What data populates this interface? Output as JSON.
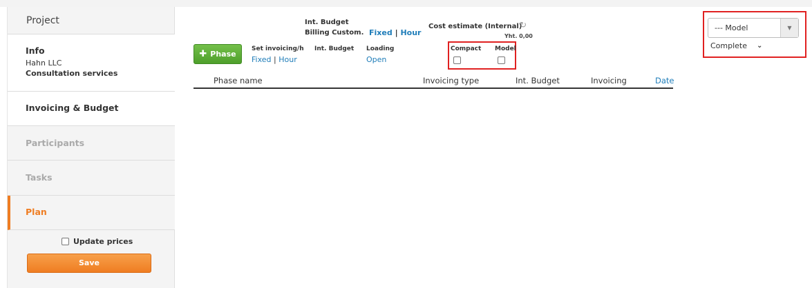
{
  "sidebar": {
    "header": "Project",
    "info_title": "Info",
    "info_client": "Hahn LLC",
    "info_service": "Consultation services",
    "items": [
      {
        "label": "Invoicing & Budget"
      },
      {
        "label": "Participants"
      },
      {
        "label": "Tasks"
      },
      {
        "label": "Plan"
      }
    ],
    "update_prices": "Update prices",
    "save": "Save"
  },
  "toolbar": {
    "int_budget": "Int. Budget",
    "billing_custom": "Billing Custom.",
    "fixed": "Fixed",
    "hour": "Hour",
    "sep": "|",
    "cost_estimate": "Cost estimate (Internal)",
    "yht": "Yht. 0,00",
    "phase_button": "Phase",
    "set_invoicing": "Set invoicing/h",
    "int_budget2": "Int. Budget",
    "loading": "Loading",
    "open": "Open",
    "compact": "Compact",
    "model": "Model"
  },
  "table": {
    "headers": [
      "Phase name",
      "Invoicing type",
      "Int. Budget",
      "Invoicing",
      "Date"
    ]
  },
  "right": {
    "model_select": "--- Model",
    "complete": "Complete"
  },
  "colors": {
    "accent": "#ef7d22",
    "link": "#1f7db9",
    "green": "#4e9f2b",
    "highlight": "#e02020"
  }
}
